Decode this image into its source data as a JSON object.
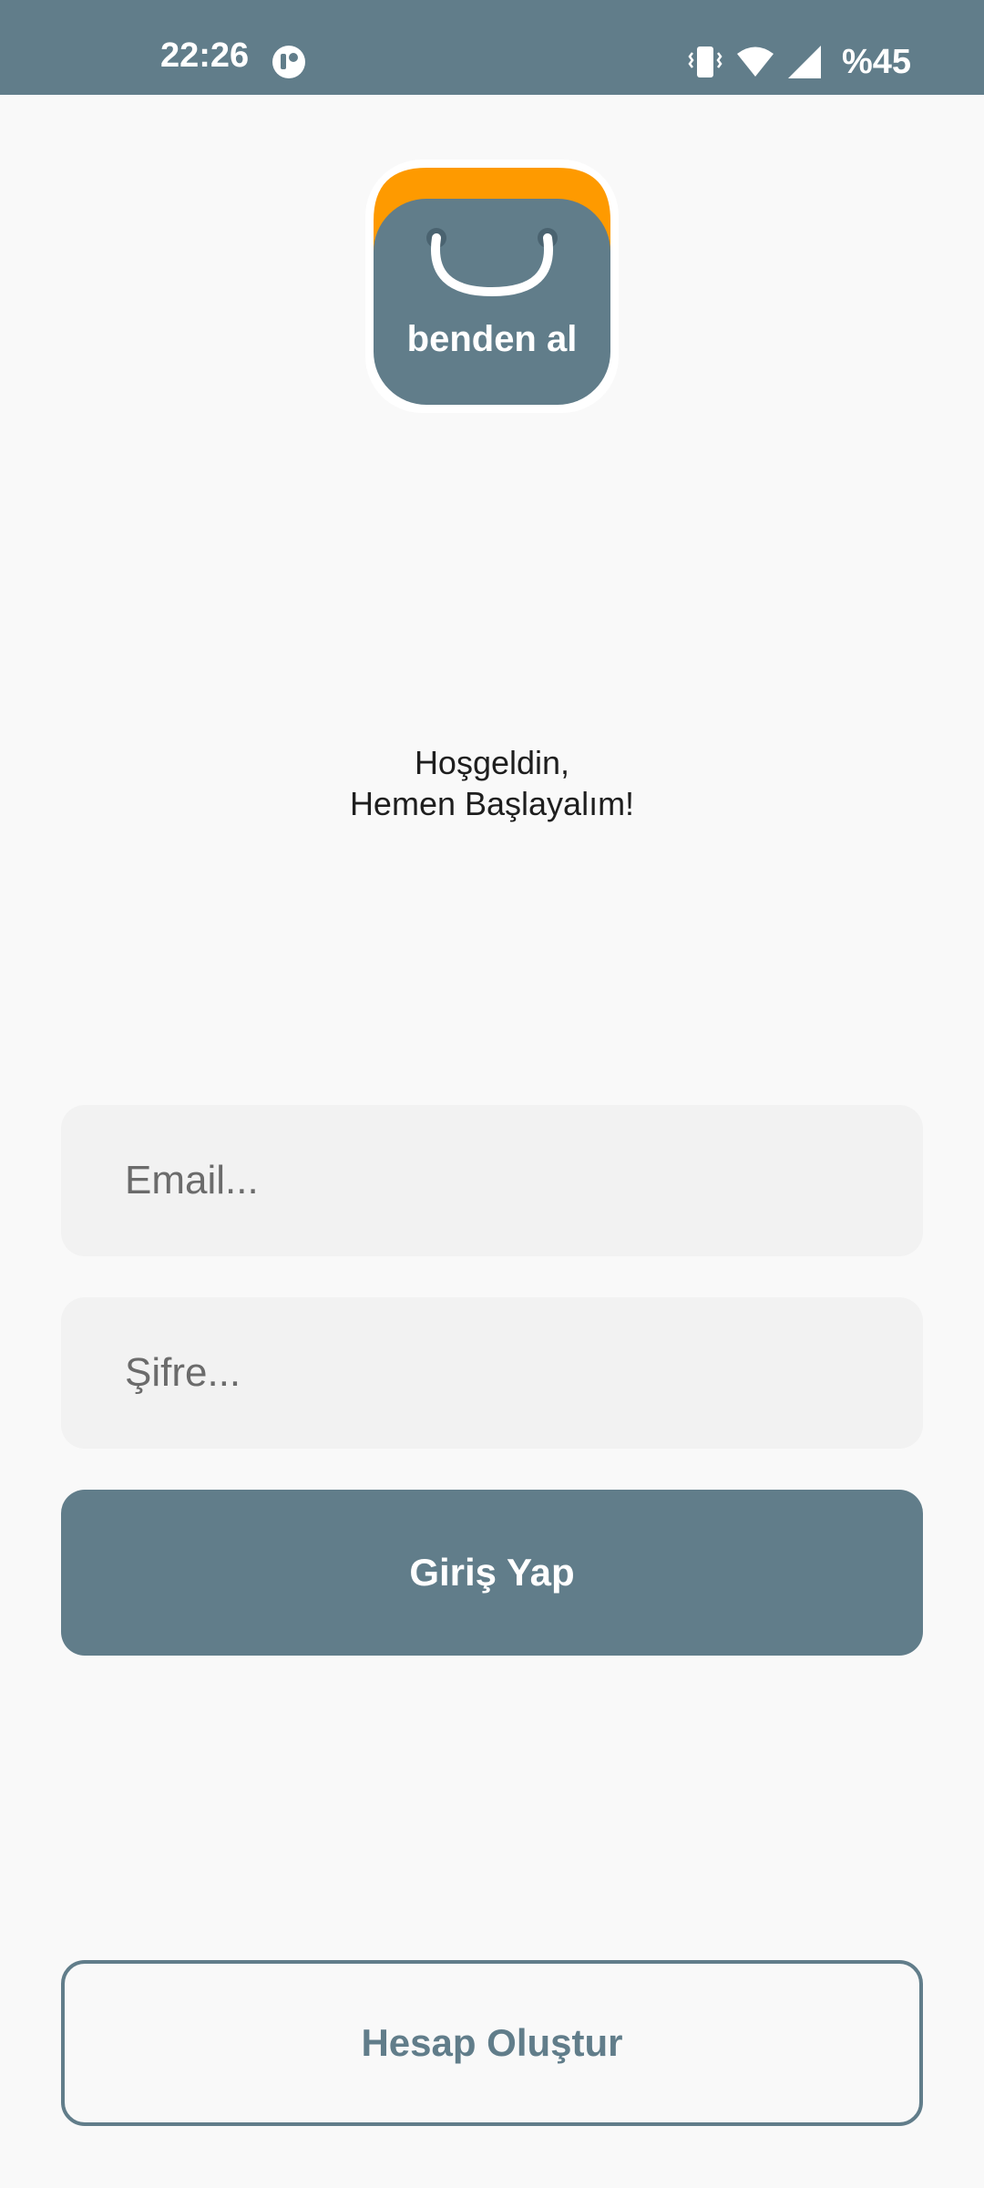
{
  "status_bar": {
    "time": "22:26",
    "battery": "%45",
    "icons": [
      "app-notification-icon",
      "vibrate-icon",
      "wifi-icon",
      "cell-signal-icon"
    ]
  },
  "logo": {
    "text": "benden al",
    "colors": {
      "bag": "#617d8a",
      "accent": "#fe9a00",
      "outline": "#ffffff"
    }
  },
  "welcome": {
    "line1": "Hoşgeldin,",
    "line2": "Hemen Başlayalım!"
  },
  "form": {
    "email": {
      "value": "",
      "placeholder": "Email..."
    },
    "password": {
      "value": "",
      "placeholder": "Şifre..."
    },
    "login_label": "Giriş Yap"
  },
  "register_label": "Hesap Oluştur",
  "theme": {
    "primary": "#617d8a",
    "background": "#f9f9f9",
    "field_background": "#f2f2f2"
  }
}
